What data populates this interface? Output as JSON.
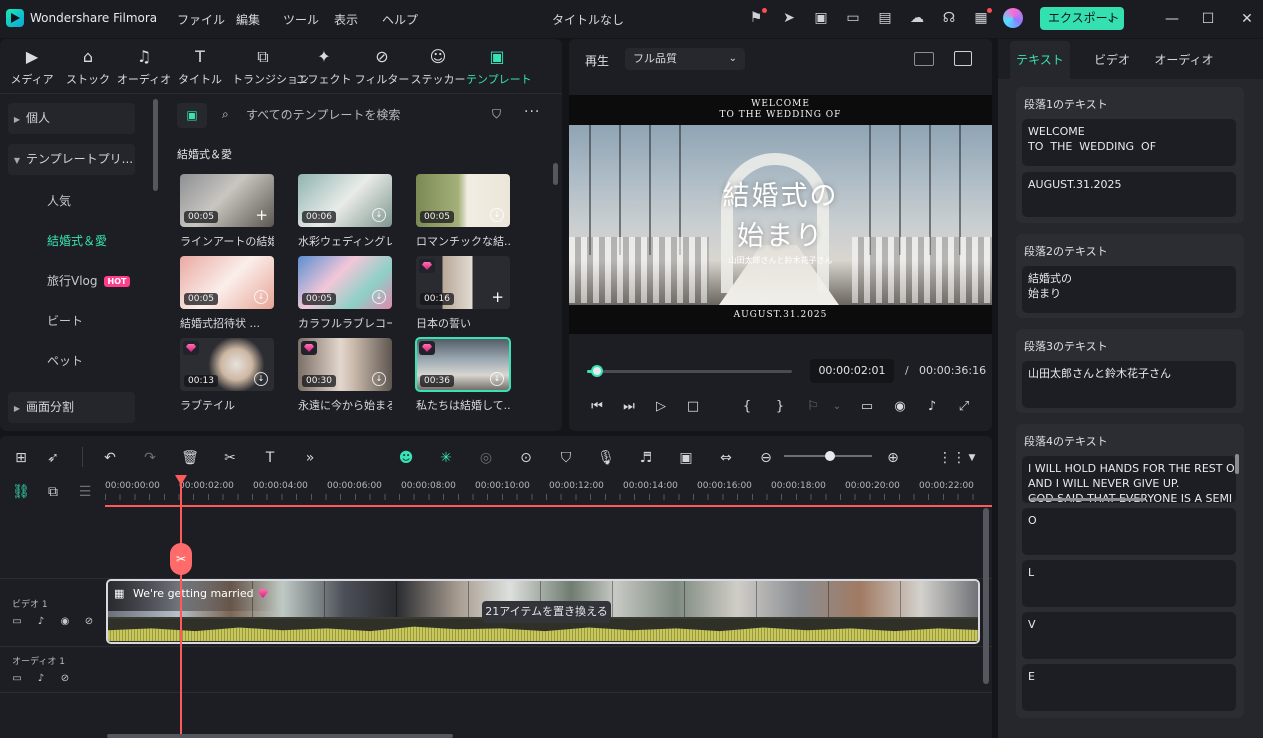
{
  "titlebar": {
    "app_name": "Wondershare Filmora",
    "menus": [
      "ファイル",
      "編集",
      "ツール",
      "表示",
      "ヘルプ"
    ],
    "doc_title": "タイトルなし",
    "export_label": "エクスポート"
  },
  "media_tabs": [
    "メディア",
    "ストック",
    "オーディオ",
    "タイトル",
    "トランジション",
    "エフェクト",
    "フィルター",
    "ステッカー",
    "テンプレート"
  ],
  "sidebar": {
    "personal": "個人",
    "template_presets": "テンプレートプリ...",
    "subitems": [
      "人気",
      "結婚式＆愛",
      "旅行Vlog",
      "ビート",
      "ペット"
    ],
    "hot_badge": "HOT",
    "split_screen": "画面分割"
  },
  "search": {
    "placeholder": "すべてのテンプレートを検索"
  },
  "category_title": "結婚式＆愛",
  "templates": [
    {
      "duration": "00:05",
      "caption": "ラインアートの結婚..."
    },
    {
      "duration": "00:06",
      "caption": "水彩ウェディングレ..."
    },
    {
      "duration": "00:05",
      "caption": "ロマンチックな結..."
    },
    {
      "duration": "00:05",
      "caption": "結婚式招待状 ..."
    },
    {
      "duration": "00:05",
      "caption": "カラフルラブレコードホ"
    },
    {
      "duration": "00:16",
      "caption": "日本の誓い"
    },
    {
      "duration": "00:13",
      "caption": "ラブテイル"
    },
    {
      "duration": "00:30",
      "caption": "永遠に今から始まる"
    },
    {
      "duration": "00:36",
      "caption": "私たちは結婚して..."
    }
  ],
  "preview": {
    "play_label": "再生",
    "quality": "フル品質",
    "overlay_welcome": "WELCOME\nTO THE WEDDING OF",
    "overlay_title": "結婚式の\n始まり",
    "overlay_names": "山田太郎さんと鈴木花子さん",
    "overlay_date": "AUGUST.31.2025",
    "current_time": "00:00:02:01",
    "time_sep": "/",
    "total_time": "00:00:36:16",
    "progress": 0.05
  },
  "right_panel": {
    "tabs": [
      "テキスト",
      "ビデオ",
      "オーディオ"
    ],
    "sections": [
      {
        "title": "段落1のテキスト",
        "texts": [
          "WELCOME\nTO  THE  WEDDING  OF",
          "AUGUST.31.2025"
        ]
      },
      {
        "title": "段落2のテキスト",
        "texts": [
          "結婚式の\n始まり"
        ]
      },
      {
        "title": "段落3のテキスト",
        "texts": [
          "山田太郎さんと鈴木花子さん"
        ]
      },
      {
        "title": "段落4のテキスト",
        "texts": [
          "I WILL HOLD HANDS FOR THE REST OF\nAND I WILL NEVER GIVE UP.\nGOD SAID THAT EVERYONE IS A SEMI",
          "O",
          "L",
          "V",
          "E"
        ]
      }
    ]
  },
  "timeline": {
    "ruler_labels": [
      "00:00:00:00",
      "00:00:02:00",
      "00:00:04:00",
      "00:00:06:00",
      "00:00:08:00",
      "00:00:10:00",
      "00:00:12:00",
      "00:00:14:00",
      "00:00:16:00",
      "00:00:18:00",
      "00:00:20:00",
      "00:00:22:00"
    ],
    "video_track_label": "ビデオ 1",
    "audio_track_label": "オーディオ 1",
    "clip_name": "We're getting married",
    "replace_tip": "21アイテムを置き換える",
    "zoom_level": 0.52
  },
  "colors": {
    "accent": "#37e2b4",
    "playhead": "#ff5a5a",
    "hot": "#ff3d8c"
  },
  "icons": [
    "gift-icon",
    "send-icon",
    "template-icon",
    "layout-icon",
    "save-icon",
    "cloud-upload-icon",
    "headset-icon",
    "apps-icon",
    "minimize-icon",
    "maximize-icon",
    "close-icon"
  ]
}
